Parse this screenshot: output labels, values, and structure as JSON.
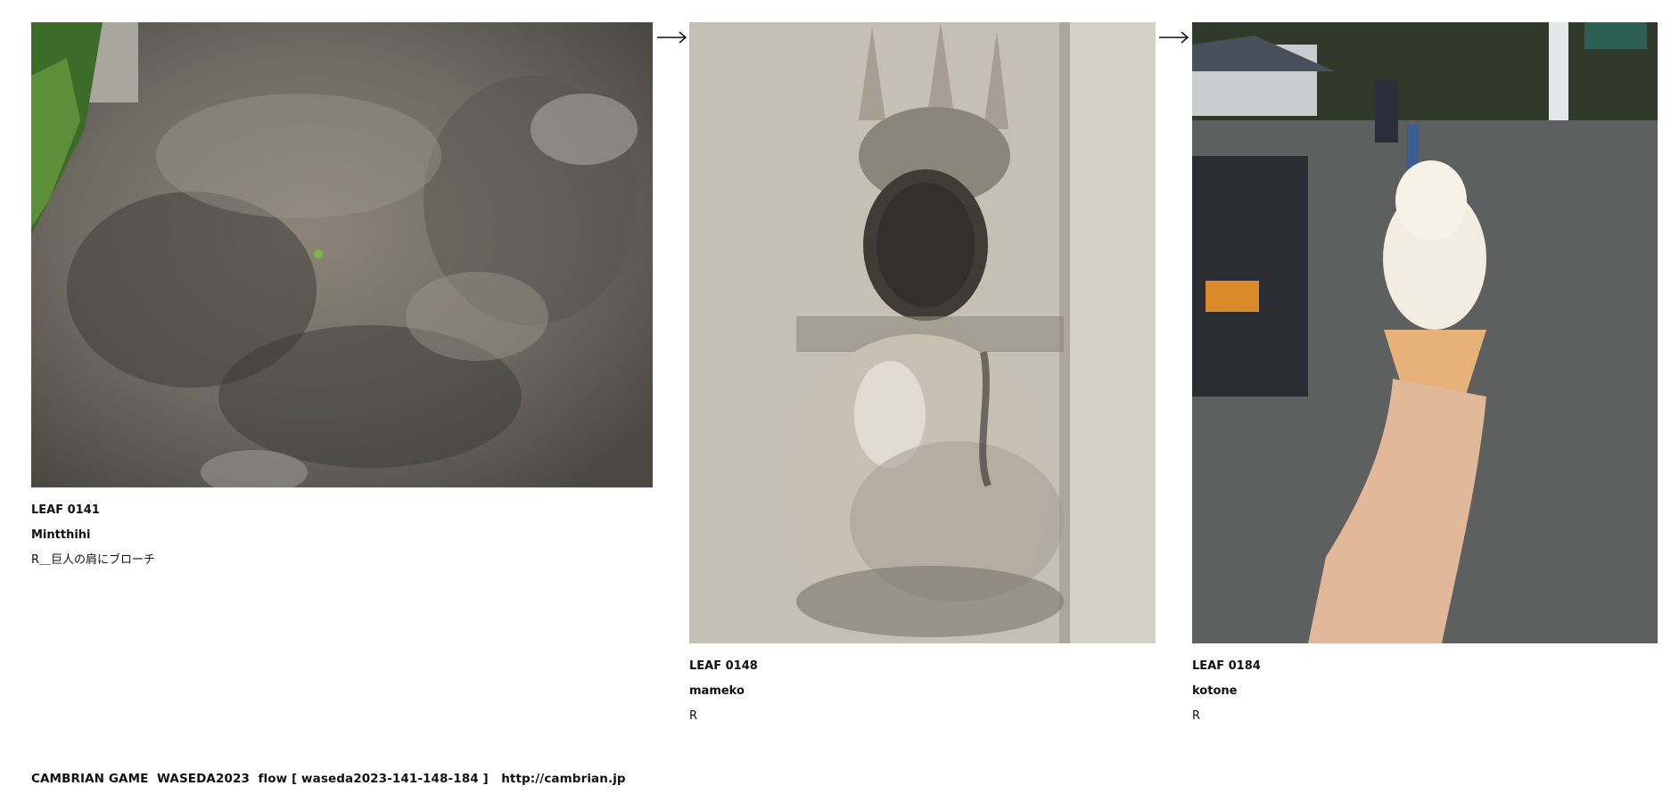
{
  "leaves": [
    {
      "id": "LEAF 0141",
      "author": "Mintthihi",
      "rule": "R＿巨人の肩にブローチ",
      "image": "lichen-covered-rock-photo"
    },
    {
      "id": "LEAF 0148",
      "author": "mameko",
      "rule": "R",
      "image": "stone-relief-carving-photo"
    },
    {
      "id": "LEAF 0184",
      "author": "kotone",
      "rule": "R",
      "image": "soft-serve-ice-cream-photo"
    }
  ],
  "arrows": [
    "arrow-right-icon",
    "arrow-right-icon"
  ],
  "footer": {
    "text": "CAMBRIAN GAME  WASEDA2023  flow [ waseda2023-141-148-184 ]   http://cambrian.jp"
  }
}
